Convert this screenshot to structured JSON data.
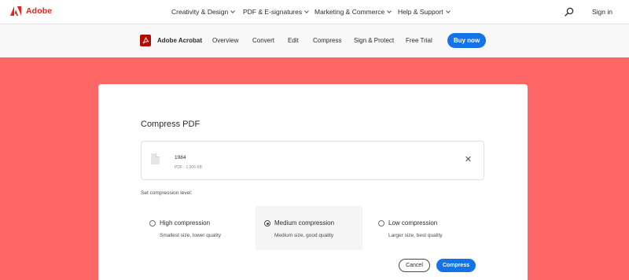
{
  "global_nav": {
    "brand": "Adobe",
    "links": [
      {
        "label": "Creativity & Design"
      },
      {
        "label": "PDF & E-signatures"
      },
      {
        "label": "Marketing & Commerce"
      },
      {
        "label": "Help & Support"
      }
    ],
    "search_icon": "search-icon",
    "sign_in": "Sign in"
  },
  "sub_nav": {
    "product": "Adobe Acrobat",
    "items": [
      {
        "label": "Overview"
      },
      {
        "label": "Convert"
      },
      {
        "label": "Edit"
      },
      {
        "label": "Compress"
      },
      {
        "label": "Sign & Protect"
      },
      {
        "label": "Free Trial"
      }
    ],
    "buy_label": "Buy now"
  },
  "compress": {
    "title": "Compress PDF",
    "file": {
      "name": "1984",
      "meta": "PDF - 1,006 KB"
    },
    "level_label": "Set compression level:",
    "options": [
      {
        "title": "High compression",
        "desc": "Smallest size, lower quality",
        "selected": false
      },
      {
        "title": "Medium compression",
        "desc": "Medium size, good quality",
        "selected": true
      },
      {
        "title": "Low compression",
        "desc": "Larger size, best quality",
        "selected": false
      }
    ],
    "cancel_label": "Cancel",
    "compress_label": "Compress"
  },
  "colors": {
    "brand_red": "#e1251b",
    "hero_bg": "#ff6766",
    "accent_blue": "#1473e6"
  }
}
